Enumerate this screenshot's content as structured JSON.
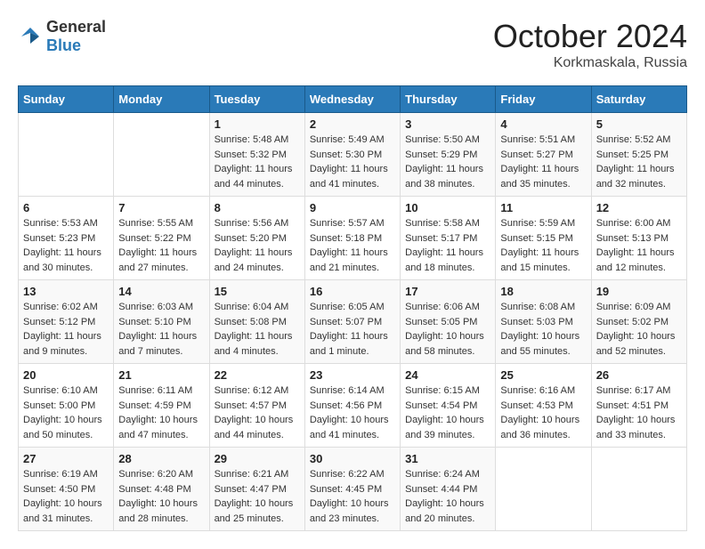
{
  "logo": {
    "general": "General",
    "blue": "Blue"
  },
  "header": {
    "month_year": "October 2024",
    "location": "Korkmaskala, Russia"
  },
  "days_of_week": [
    "Sunday",
    "Monday",
    "Tuesday",
    "Wednesday",
    "Thursday",
    "Friday",
    "Saturday"
  ],
  "weeks": [
    [
      {
        "day": "",
        "info": ""
      },
      {
        "day": "",
        "info": ""
      },
      {
        "day": "1",
        "info": "Sunrise: 5:48 AM\nSunset: 5:32 PM\nDaylight: 11 hours and 44 minutes."
      },
      {
        "day": "2",
        "info": "Sunrise: 5:49 AM\nSunset: 5:30 PM\nDaylight: 11 hours and 41 minutes."
      },
      {
        "day": "3",
        "info": "Sunrise: 5:50 AM\nSunset: 5:29 PM\nDaylight: 11 hours and 38 minutes."
      },
      {
        "day": "4",
        "info": "Sunrise: 5:51 AM\nSunset: 5:27 PM\nDaylight: 11 hours and 35 minutes."
      },
      {
        "day": "5",
        "info": "Sunrise: 5:52 AM\nSunset: 5:25 PM\nDaylight: 11 hours and 32 minutes."
      }
    ],
    [
      {
        "day": "6",
        "info": "Sunrise: 5:53 AM\nSunset: 5:23 PM\nDaylight: 11 hours and 30 minutes."
      },
      {
        "day": "7",
        "info": "Sunrise: 5:55 AM\nSunset: 5:22 PM\nDaylight: 11 hours and 27 minutes."
      },
      {
        "day": "8",
        "info": "Sunrise: 5:56 AM\nSunset: 5:20 PM\nDaylight: 11 hours and 24 minutes."
      },
      {
        "day": "9",
        "info": "Sunrise: 5:57 AM\nSunset: 5:18 PM\nDaylight: 11 hours and 21 minutes."
      },
      {
        "day": "10",
        "info": "Sunrise: 5:58 AM\nSunset: 5:17 PM\nDaylight: 11 hours and 18 minutes."
      },
      {
        "day": "11",
        "info": "Sunrise: 5:59 AM\nSunset: 5:15 PM\nDaylight: 11 hours and 15 minutes."
      },
      {
        "day": "12",
        "info": "Sunrise: 6:00 AM\nSunset: 5:13 PM\nDaylight: 11 hours and 12 minutes."
      }
    ],
    [
      {
        "day": "13",
        "info": "Sunrise: 6:02 AM\nSunset: 5:12 PM\nDaylight: 11 hours and 9 minutes."
      },
      {
        "day": "14",
        "info": "Sunrise: 6:03 AM\nSunset: 5:10 PM\nDaylight: 11 hours and 7 minutes."
      },
      {
        "day": "15",
        "info": "Sunrise: 6:04 AM\nSunset: 5:08 PM\nDaylight: 11 hours and 4 minutes."
      },
      {
        "day": "16",
        "info": "Sunrise: 6:05 AM\nSunset: 5:07 PM\nDaylight: 11 hours and 1 minute."
      },
      {
        "day": "17",
        "info": "Sunrise: 6:06 AM\nSunset: 5:05 PM\nDaylight: 10 hours and 58 minutes."
      },
      {
        "day": "18",
        "info": "Sunrise: 6:08 AM\nSunset: 5:03 PM\nDaylight: 10 hours and 55 minutes."
      },
      {
        "day": "19",
        "info": "Sunrise: 6:09 AM\nSunset: 5:02 PM\nDaylight: 10 hours and 52 minutes."
      }
    ],
    [
      {
        "day": "20",
        "info": "Sunrise: 6:10 AM\nSunset: 5:00 PM\nDaylight: 10 hours and 50 minutes."
      },
      {
        "day": "21",
        "info": "Sunrise: 6:11 AM\nSunset: 4:59 PM\nDaylight: 10 hours and 47 minutes."
      },
      {
        "day": "22",
        "info": "Sunrise: 6:12 AM\nSunset: 4:57 PM\nDaylight: 10 hours and 44 minutes."
      },
      {
        "day": "23",
        "info": "Sunrise: 6:14 AM\nSunset: 4:56 PM\nDaylight: 10 hours and 41 minutes."
      },
      {
        "day": "24",
        "info": "Sunrise: 6:15 AM\nSunset: 4:54 PM\nDaylight: 10 hours and 39 minutes."
      },
      {
        "day": "25",
        "info": "Sunrise: 6:16 AM\nSunset: 4:53 PM\nDaylight: 10 hours and 36 minutes."
      },
      {
        "day": "26",
        "info": "Sunrise: 6:17 AM\nSunset: 4:51 PM\nDaylight: 10 hours and 33 minutes."
      }
    ],
    [
      {
        "day": "27",
        "info": "Sunrise: 6:19 AM\nSunset: 4:50 PM\nDaylight: 10 hours and 31 minutes."
      },
      {
        "day": "28",
        "info": "Sunrise: 6:20 AM\nSunset: 4:48 PM\nDaylight: 10 hours and 28 minutes."
      },
      {
        "day": "29",
        "info": "Sunrise: 6:21 AM\nSunset: 4:47 PM\nDaylight: 10 hours and 25 minutes."
      },
      {
        "day": "30",
        "info": "Sunrise: 6:22 AM\nSunset: 4:45 PM\nDaylight: 10 hours and 23 minutes."
      },
      {
        "day": "31",
        "info": "Sunrise: 6:24 AM\nSunset: 4:44 PM\nDaylight: 10 hours and 20 minutes."
      },
      {
        "day": "",
        "info": ""
      },
      {
        "day": "",
        "info": ""
      }
    ]
  ]
}
